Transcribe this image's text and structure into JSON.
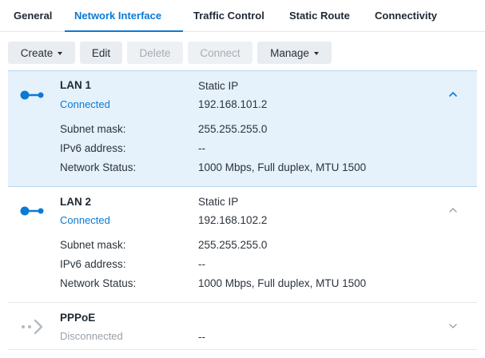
{
  "tabs": [
    {
      "label": "General"
    },
    {
      "label": "Network Interface"
    },
    {
      "label": "Traffic Control"
    },
    {
      "label": "Static Route"
    },
    {
      "label": "Connectivity"
    }
  ],
  "toolbar": {
    "create": "Create",
    "edit": "Edit",
    "delete": "Delete",
    "connect": "Connect",
    "manage": "Manage"
  },
  "fields": {
    "subnet": "Subnet mask:",
    "ipv6": "IPv6 address:",
    "netstatus": "Network Status:"
  },
  "interfaces": [
    {
      "name": "LAN 1",
      "status": "Connected",
      "ip_mode": "Static IP",
      "ip": "192.168.101.2",
      "subnet": "255.255.255.0",
      "ipv6": "--",
      "network_status": "1000 Mbps, Full duplex, MTU 1500"
    },
    {
      "name": "LAN 2",
      "status": "Connected",
      "ip_mode": "Static IP",
      "ip": "192.168.102.2",
      "subnet": "255.255.255.0",
      "ipv6": "--",
      "network_status": "1000 Mbps, Full duplex, MTU 1500"
    },
    {
      "name": "PPPoE",
      "status": "Disconnected",
      "ip_value": "--"
    }
  ],
  "colors": {
    "accent": "#0a7ad6",
    "selected_bg": "#e5f1fb",
    "disconnected": "#9aa1a9"
  }
}
